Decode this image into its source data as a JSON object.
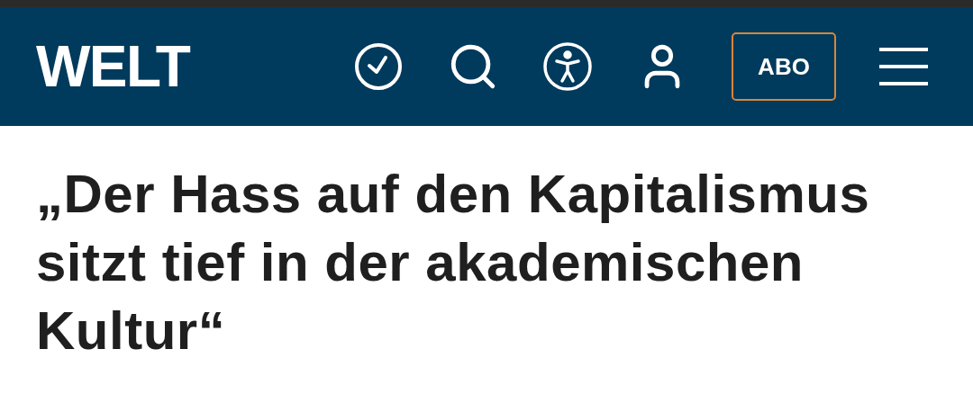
{
  "header": {
    "logo": "WELT",
    "subscribe_button": "ABO"
  },
  "article": {
    "headline": "„Der Hass auf den Kapitalismus sitzt tief in der akademischen Kultur“"
  }
}
